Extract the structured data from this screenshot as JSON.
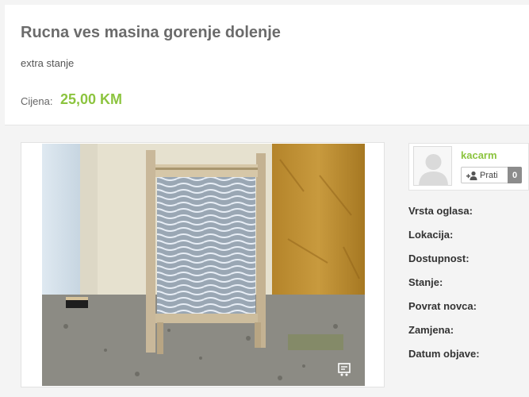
{
  "listing": {
    "title": "Rucna ves masina gorenje dolenje",
    "description": "extra stanje",
    "price_label": "Cijena:",
    "price_value": "25,00 KM"
  },
  "seller": {
    "username": "kacarm",
    "follow_label": "Prati",
    "follow_count": "0"
  },
  "details": [
    {
      "label": "Vrsta oglasa:"
    },
    {
      "label": "Lokacija:"
    },
    {
      "label": "Dostupnost:"
    },
    {
      "label": "Stanje:"
    },
    {
      "label": "Povrat novca:"
    },
    {
      "label": "Zamjena:"
    },
    {
      "label": "Datum objave:"
    }
  ],
  "icons": {
    "follow": "person-plus-icon",
    "gallery": "gallery-icon",
    "avatar": "default-avatar"
  },
  "colors": {
    "accent": "#8cc43f",
    "title": "#6b6b6b"
  }
}
